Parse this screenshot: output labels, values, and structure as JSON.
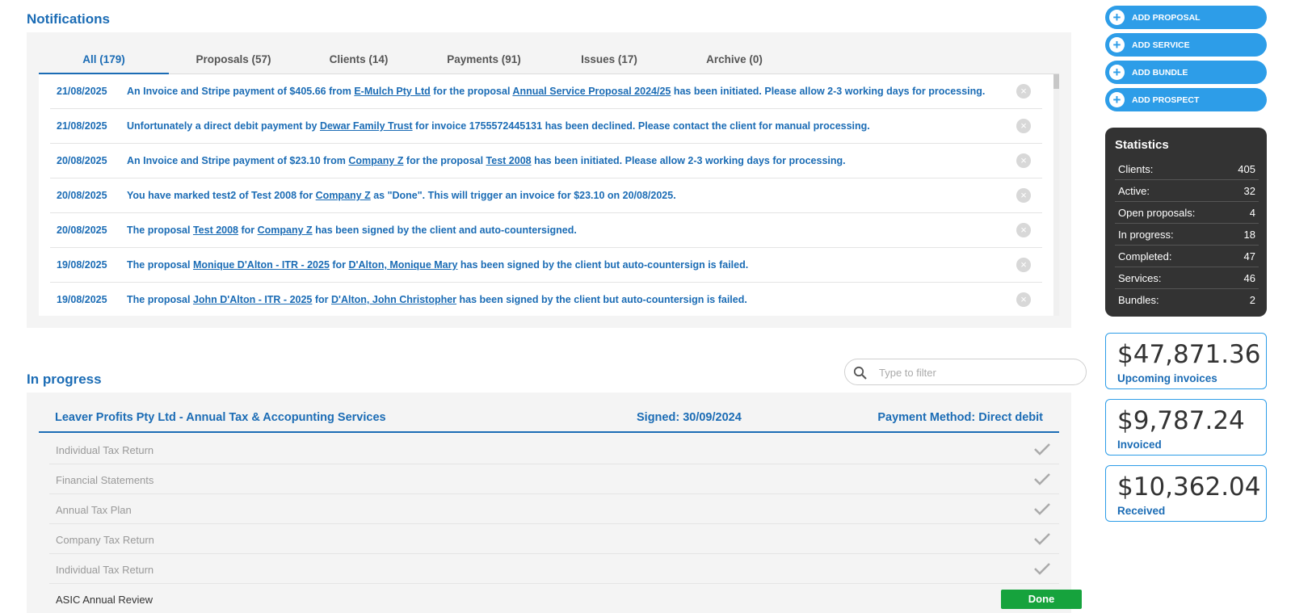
{
  "notifications": {
    "title": "Notifications",
    "tabs": [
      {
        "label": "All (179)"
      },
      {
        "label": "Proposals (57)"
      },
      {
        "label": "Clients (14)"
      },
      {
        "label": "Payments (91)"
      },
      {
        "label": "Issues (17)"
      },
      {
        "label": "Archive (0)"
      }
    ],
    "items": [
      {
        "date": "21/08/2025",
        "parts": [
          "An Invoice and Stripe payment of $405.66 from ",
          "E-Mulch Pty Ltd",
          " for the proposal ",
          "Annual Service Proposal 2024/25",
          " has been initiated. Please allow 2-3 working days for processing."
        ]
      },
      {
        "date": "21/08/2025",
        "parts": [
          "Unfortunately a direct debit payment by ",
          "Dewar Family Trust",
          " for invoice 1755572445131 has been declined. Please contact the client for manual processing."
        ]
      },
      {
        "date": "20/08/2025",
        "parts": [
          "An Invoice and Stripe payment of $23.10 from ",
          "Company Z",
          " for the proposal ",
          "Test 2008",
          " has been initiated. Please allow 2-3 working days for processing."
        ]
      },
      {
        "date": "20/08/2025",
        "parts": [
          "You have marked test2 of Test 2008 for ",
          "Company Z",
          " as \"Done\". This will trigger an invoice for $23.10 on 20/08/2025."
        ]
      },
      {
        "date": "20/08/2025",
        "parts": [
          "The proposal ",
          "Test 2008",
          " for ",
          "Company Z",
          " has been signed by the client and auto-countersigned."
        ]
      },
      {
        "date": "19/08/2025",
        "parts": [
          "The proposal ",
          "Monique D'Alton - ITR - 2025",
          " for ",
          "D'Alton, Monique Mary",
          " has been signed by the client but auto-countersign is failed."
        ]
      },
      {
        "date": "19/08/2025",
        "parts": [
          "The proposal ",
          "John D'Alton - ITR - 2025",
          " for ",
          "D'Alton, John Christopher",
          " has been signed by the client but auto-countersign is failed."
        ]
      }
    ]
  },
  "in_progress": {
    "title": "In progress",
    "filter_placeholder": "Type to filter",
    "project": {
      "name": "Leaver Profits Pty Ltd - Annual Tax & Accopunting Services",
      "signed": "Signed: 30/09/2024",
      "payment": "Payment Method: Direct debit"
    },
    "services": [
      {
        "name": "Individual Tax Return",
        "status": "check"
      },
      {
        "name": "Financial Statements",
        "status": "check"
      },
      {
        "name": "Annual Tax Plan",
        "status": "check"
      },
      {
        "name": "Company Tax Return",
        "status": "check"
      },
      {
        "name": "Individual Tax Return",
        "status": "check"
      },
      {
        "name": "ASIC Annual Review",
        "status": "done",
        "button_label": "Done"
      }
    ]
  },
  "actions": {
    "add_proposal": "ADD PROPOSAL",
    "add_service": "ADD SERVICE",
    "add_bundle": "ADD BUNDLE",
    "add_prospect": "ADD PROSPECT"
  },
  "statistics": {
    "title": "Statistics",
    "rows": [
      {
        "label": "Clients:",
        "value": "405"
      },
      {
        "label": "Active:",
        "value": "32"
      },
      {
        "label": "Open proposals:",
        "value": "4"
      },
      {
        "label": "In progress:",
        "value": "18"
      },
      {
        "label": "Completed:",
        "value": "47"
      },
      {
        "label": "Services:",
        "value": "46"
      },
      {
        "label": "Bundles:",
        "value": "2"
      }
    ]
  },
  "money": [
    {
      "amount": "$47,871.36",
      "caption": "Upcoming invoices"
    },
    {
      "amount": "$9,787.24",
      "caption": "Invoiced"
    },
    {
      "amount": "$10,362.04",
      "caption": "Received"
    }
  ],
  "colors": {
    "accent": "#1b6cb5",
    "button": "#2d9de8",
    "done": "#16a33d",
    "stats_bg": "#333333"
  }
}
